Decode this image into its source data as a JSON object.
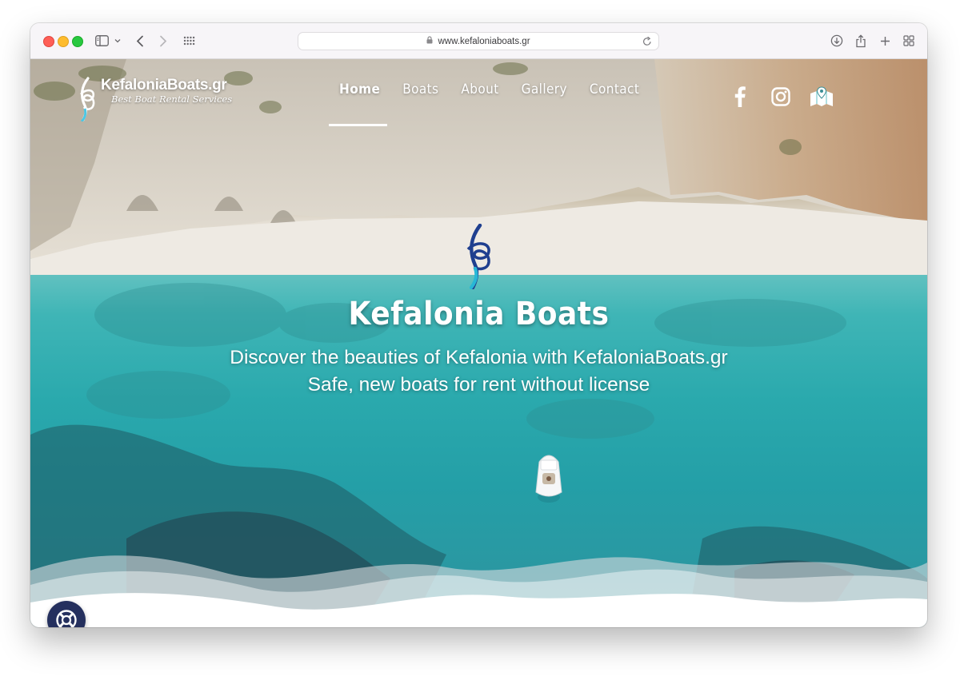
{
  "browser": {
    "url": "www.kefaloniaboats.gr",
    "toolbar_icons": [
      "sidebar-icon",
      "chevron-down-icon",
      "back-icon",
      "forward-icon",
      "tab-grid-icon",
      "lock-icon",
      "reload-icon",
      "download-icon",
      "share-icon",
      "new-tab-icon",
      "tab-overview-icon"
    ]
  },
  "site": {
    "logo": {
      "name": "KefaloniaBoats.gr",
      "tagline": "Best Boat Rental Services"
    },
    "nav": [
      {
        "label": "Home",
        "active": true
      },
      {
        "label": "Boats",
        "active": false
      },
      {
        "label": "About",
        "active": false
      },
      {
        "label": "Gallery",
        "active": false
      },
      {
        "label": "Contact",
        "active": false
      }
    ],
    "social_icons": [
      "facebook-icon",
      "instagram-icon",
      "map-icon"
    ],
    "hero": {
      "title": "Kefalonia Boats",
      "subtitle_line1": "Discover the beauties of Kefalonia with KefaloniaBoats.gr",
      "subtitle_line2": "Safe, new boats for rent without license"
    },
    "help_icon": "lifebuoy-icon"
  },
  "colors": {
    "brand_navy": "#25305e",
    "brand_blue": "#1f3f8f",
    "accent_cyan": "#27b7d6",
    "sea": "#2aa9ad"
  }
}
